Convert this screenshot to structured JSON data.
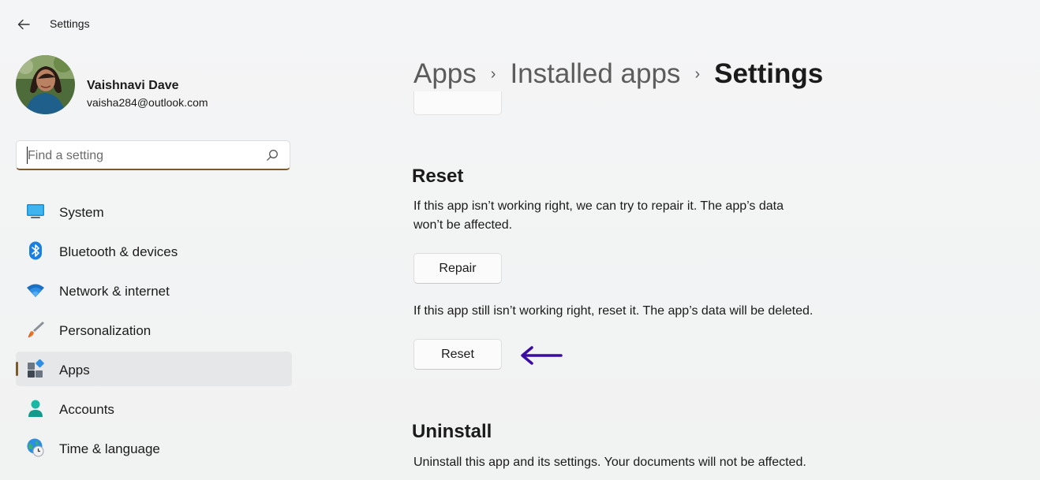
{
  "window": {
    "title": "Settings"
  },
  "user": {
    "name": "Vaishnavi Dave",
    "email": "vaisha284@outlook.com"
  },
  "search": {
    "placeholder": "Find a setting"
  },
  "sidebar": {
    "items": [
      {
        "label": "System",
        "icon": "system-icon"
      },
      {
        "label": "Bluetooth & devices",
        "icon": "bluetooth-icon"
      },
      {
        "label": "Network & internet",
        "icon": "wifi-icon"
      },
      {
        "label": "Personalization",
        "icon": "brush-icon"
      },
      {
        "label": "Apps",
        "icon": "apps-icon",
        "selected": true
      },
      {
        "label": "Accounts",
        "icon": "person-icon"
      },
      {
        "label": "Time & language",
        "icon": "globe-clock-icon"
      }
    ]
  },
  "breadcrumb": [
    "Apps",
    "Installed apps",
    "Settings"
  ],
  "reset_section": {
    "title": "Reset",
    "repair_text": "If this app isn’t working right, we can try to repair it. The app’s data won’t be affected.",
    "repair_text_line1": "If this app isn’t working right, we can try to repair it. The app’s data",
    "repair_text_line2": "won’t be affected.",
    "repair_button": "Repair",
    "reset_text": "If this app still isn’t working right, reset it. The app’s data will be deleted.",
    "reset_button": "Reset"
  },
  "uninstall_section": {
    "title": "Uninstall",
    "text": "Uninstall this app and its settings. Your documents will not be affected."
  },
  "colors": {
    "accent": "#7a5a2a",
    "annotation_arrow": "#3a0ca3"
  }
}
